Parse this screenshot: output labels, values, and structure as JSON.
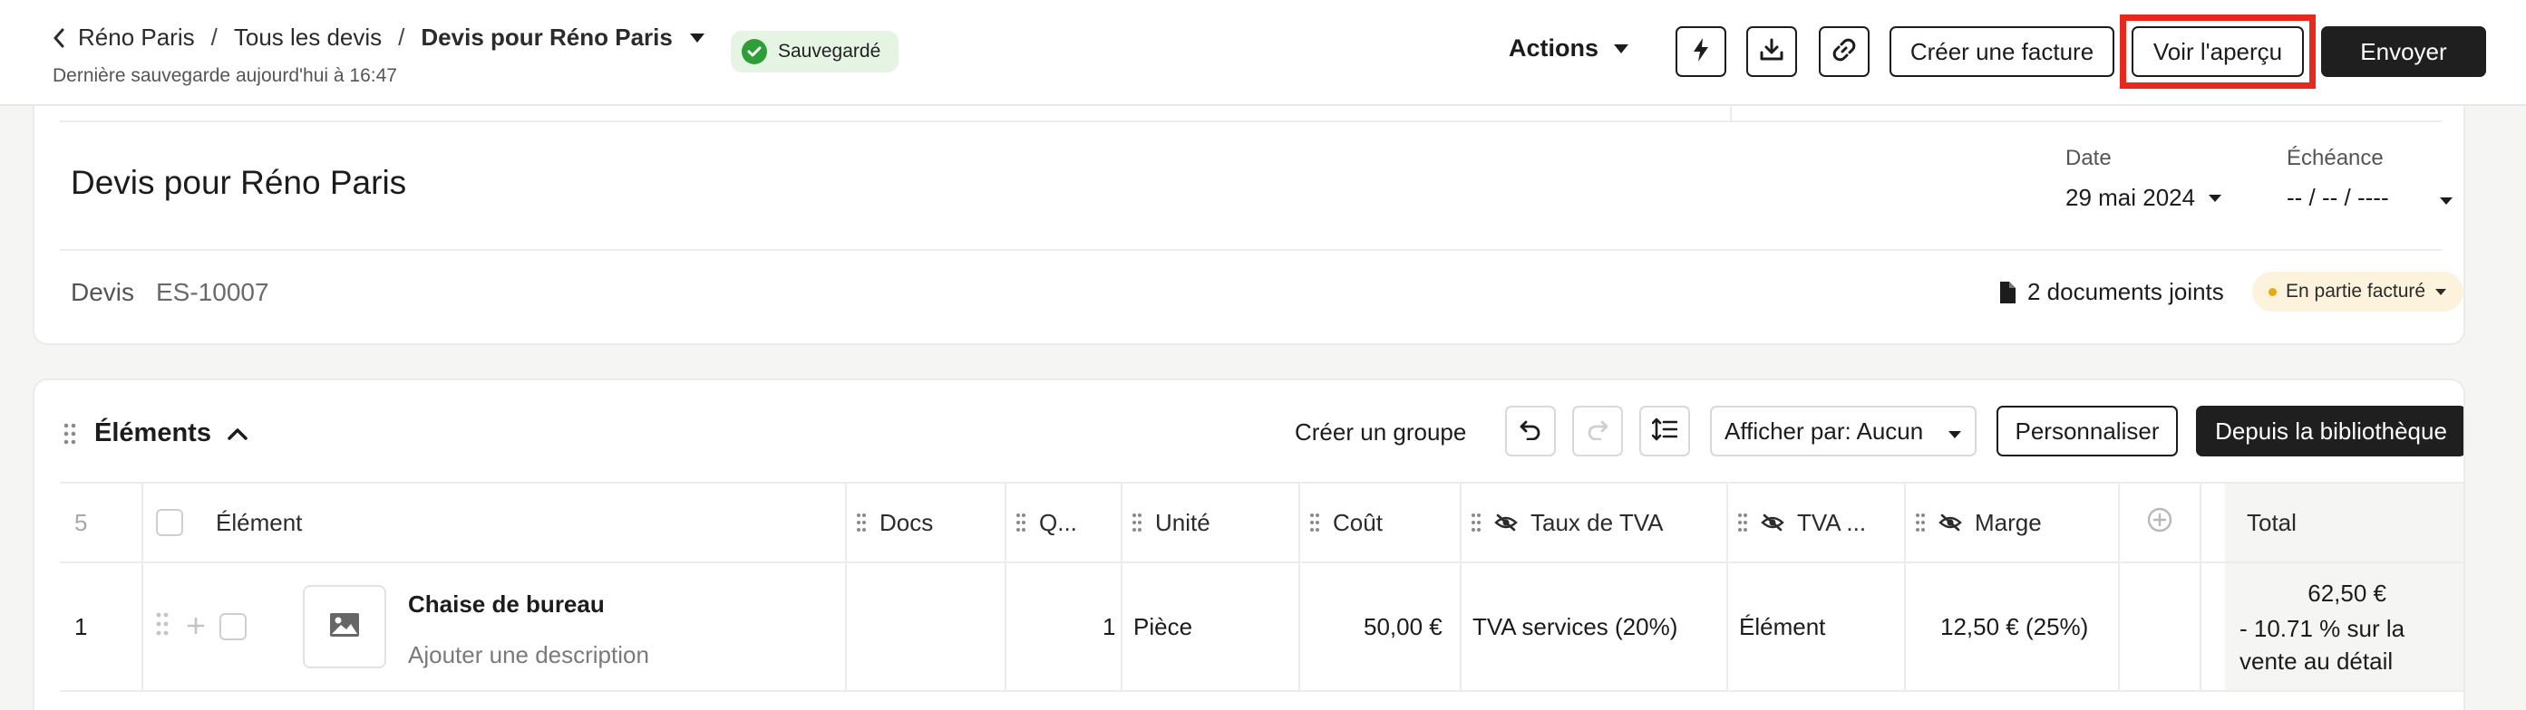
{
  "header": {
    "breadcrumb": [
      "Réno Paris",
      "Tous les devis",
      "Devis pour Réno Paris"
    ],
    "breadcrumb_sep": "/",
    "last_save": "Dernière sauvegarde aujourd'hui à 16:47",
    "saved_badge": "Sauvegardé",
    "actions_label": "Actions",
    "create_invoice": "Créer une facture",
    "preview": "Voir l'aperçu",
    "send": "Envoyer"
  },
  "document": {
    "title": "Devis pour Réno Paris",
    "date_label": "Date",
    "date_value": "29 mai 2024",
    "due_label": "Échéance",
    "due_value": "-- / -- / ----",
    "type_label": "Devis",
    "number": "ES-10007",
    "attachments": "2 documents joints",
    "status": "En partie facturé"
  },
  "elements": {
    "title": "Éléments",
    "create_group": "Créer un groupe",
    "show_by": "Afficher par: Aucun",
    "customize": "Personnaliser",
    "from_library": "Depuis la bibliothèque",
    "columns": {
      "count": "5",
      "element": "Élément",
      "docs": "Docs",
      "qty": "Q...",
      "unit": "Unité",
      "cost": "Coût",
      "vat_rate": "Taux de TVA",
      "vat": "TVA ...",
      "margin": "Marge",
      "total": "Total"
    },
    "rows": [
      {
        "index": "1",
        "name": "Chaise de bureau",
        "description": "Ajouter une description",
        "qty": "1",
        "unit": "Pièce",
        "cost": "50,00 €",
        "vat_rate": "TVA services (20%)",
        "vat": "Élément",
        "margin": "12,50 € (25%)",
        "total": "62,50 €",
        "total_note": "- 10.71 % sur la vente au détail"
      }
    ]
  },
  "colors": {
    "accent_dark": "#1f1f1f",
    "saved_green": "#2e9e38",
    "highlight_red": "#e8281c",
    "status_yellow": "#e6a817"
  },
  "icons": [
    "chevron-left-icon",
    "caret-down-icon",
    "check-icon",
    "lightning-icon",
    "download-icon",
    "link-icon",
    "file-icon",
    "grip-icon",
    "chevron-up-icon",
    "undo-icon",
    "redo-icon",
    "line-spacing-icon",
    "eye-off-icon",
    "plus-circle-icon",
    "image-icon",
    "plus-icon"
  ]
}
